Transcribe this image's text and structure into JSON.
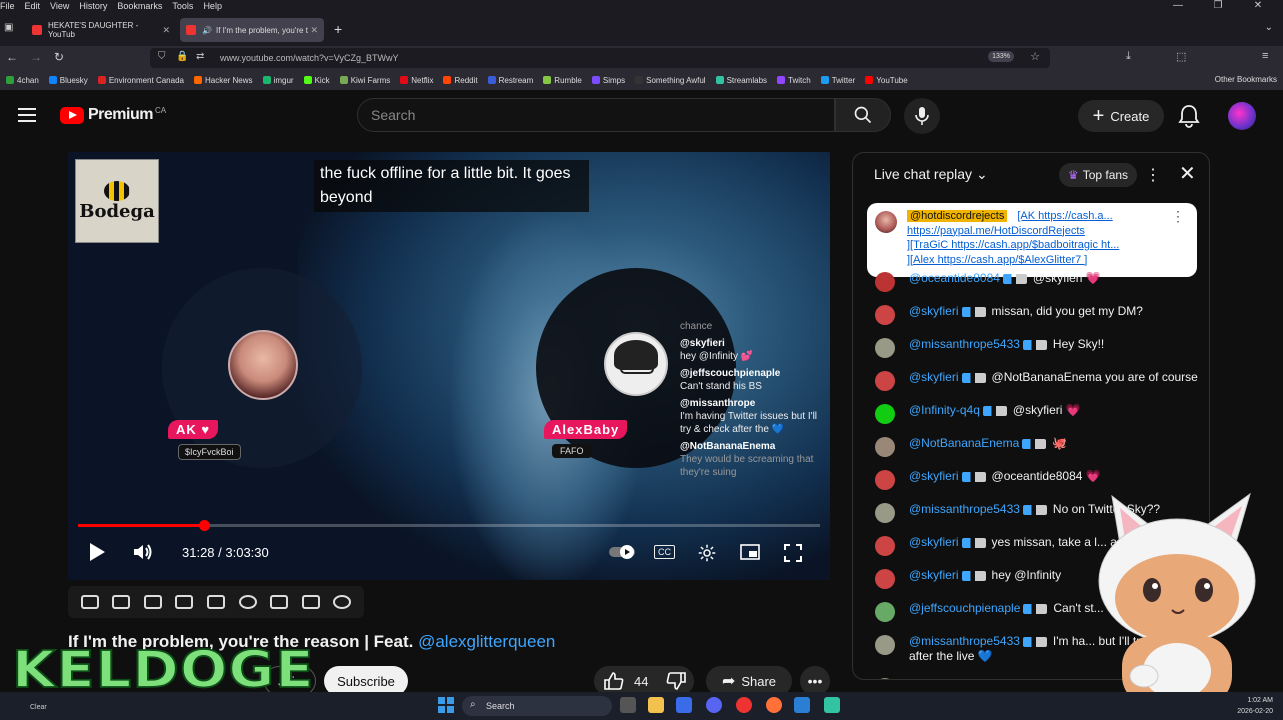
{
  "menubar": {
    "items": [
      "File",
      "Edit",
      "View",
      "History",
      "Bookmarks",
      "Tools",
      "Help"
    ]
  },
  "tabs": [
    {
      "title": "HEKATE'S DAUGHTER - YouTub",
      "active": false
    },
    {
      "title": "If I'm the problem, you're t",
      "active": true
    }
  ],
  "url": "www.youtube.com/watch?v=VyCZg_BTWwY",
  "zoom": "133%",
  "bookmarks": [
    {
      "label": "4chan",
      "color": "#2e9e3a"
    },
    {
      "label": "Bluesky",
      "color": "#1185fe"
    },
    {
      "label": "Environment Canada",
      "color": "#d22"
    },
    {
      "label": "Hacker News",
      "color": "#f60"
    },
    {
      "label": "imgur",
      "color": "#1bb76e"
    },
    {
      "label": "Kick",
      "color": "#53fc18"
    },
    {
      "label": "Kiwi Farms",
      "color": "#7a5"
    },
    {
      "label": "Netflix",
      "color": "#e50914"
    },
    {
      "label": "Reddit",
      "color": "#ff4500"
    },
    {
      "label": "Restream",
      "color": "#3b5bdb"
    },
    {
      "label": "Rumble",
      "color": "#85c742"
    },
    {
      "label": "Simps",
      "color": "#7c4dff"
    },
    {
      "label": "Something Awful",
      "color": "#333"
    },
    {
      "label": "Streamlabs",
      "color": "#31c3a2"
    },
    {
      "label": "Twitch",
      "color": "#9146ff"
    },
    {
      "label": "Twitter",
      "color": "#1d9bf0"
    },
    {
      "label": "YouTube",
      "color": "#f00"
    }
  ],
  "bookmarks_other": "Other Bookmarks",
  "yt": {
    "logo_word": "Premium",
    "region": "CA",
    "search_placeholder": "Search",
    "create_label": "Create"
  },
  "video": {
    "bodega_label": "Bodega",
    "caption": "the fuck offline for a little bit. It goes beyond",
    "left_name": "AK ♥",
    "left_sub": "$IcyFvckBoi",
    "right_name": "AlexBaby",
    "right_sub": "FAFO",
    "overlay_chat": [
      {
        "user": "",
        "text": "chance",
        "dim": true
      },
      {
        "user": "@skyfieri",
        "text": "hey @Infinity 💕"
      },
      {
        "user": "@jeffscouchpienaple",
        "text": "Can't stand his BS"
      },
      {
        "user": "@missanthrope",
        "text": "I'm having Twitter issues but I'll try & check after the 💙"
      },
      {
        "user": "@NotBananaEnema",
        "text": "They would be screaming that they're suing"
      }
    ],
    "time_current": "31:28",
    "time_total": "3:03:30",
    "time_display": "31:28 / 3:03:30",
    "progress_fraction": 0.17,
    "cc_label": "CC"
  },
  "title": {
    "text": "If I'm the problem, you're the reason | Feat. ",
    "link": "@alexglitterqueen"
  },
  "actions": {
    "join": "Join",
    "subscribe": "Subscribe",
    "likes": "44",
    "share": "Share"
  },
  "overlay_brand": "KELDOGE",
  "chat": {
    "header": "Live chat replay",
    "top_fans": "Top fans",
    "pinned": {
      "user": "@hotdiscordrejects",
      "line1": "[AK https://cash.a...",
      "line2": "https://paypal.me/HotDiscordRejects",
      "line3": "][TraGiC https://cash.app/$badboitragic ht...",
      "line4": "][Alex https://cash.app/$AlexGlitter7 ]"
    },
    "messages": [
      {
        "user": "@oceantide8084",
        "text": "@skyfieri 💗",
        "color": "#b33"
      },
      {
        "user": "@skyfieri",
        "text": "missan, did you get my DM?",
        "color": "#c44"
      },
      {
        "user": "@missanthrope5433",
        "text": "Hey Sky!!",
        "color": "#998"
      },
      {
        "user": "@skyfieri",
        "text": "@NotBananaEnema you are of course",
        "color": "#c44"
      },
      {
        "user": "@Infinity-q4q",
        "text": "@skyfieri 💗",
        "color": "#1c1"
      },
      {
        "user": "@NotBananaEnema",
        "text": "🐙",
        "color": "#987"
      },
      {
        "user": "@skyfieri",
        "text": "@oceantide8084 💗",
        "color": "#c44"
      },
      {
        "user": "@missanthrope5433",
        "text": "No on Twitter Sky??",
        "color": "#998"
      },
      {
        "user": "@skyfieri",
        "text": "yes missan, take a l... a chance",
        "color": "#c44"
      },
      {
        "user": "@skyfieri",
        "text": "hey @Infinity",
        "color": "#c44"
      },
      {
        "user": "@jeffscouchpienaple",
        "text": "Can't st...",
        "color": "#6a6"
      },
      {
        "user": "@missanthrope5433",
        "text": "I'm ha... but I'll try & check after the live 💙",
        "color": "#998"
      },
      {
        "user": "@NotBananaEnema",
        "text": "They wo... that they're suing.",
        "color": "#987"
      }
    ]
  },
  "taskbar": {
    "weather": "Clear",
    "search": "Search",
    "time": "1:02 AM",
    "date": "2026-02-20"
  }
}
